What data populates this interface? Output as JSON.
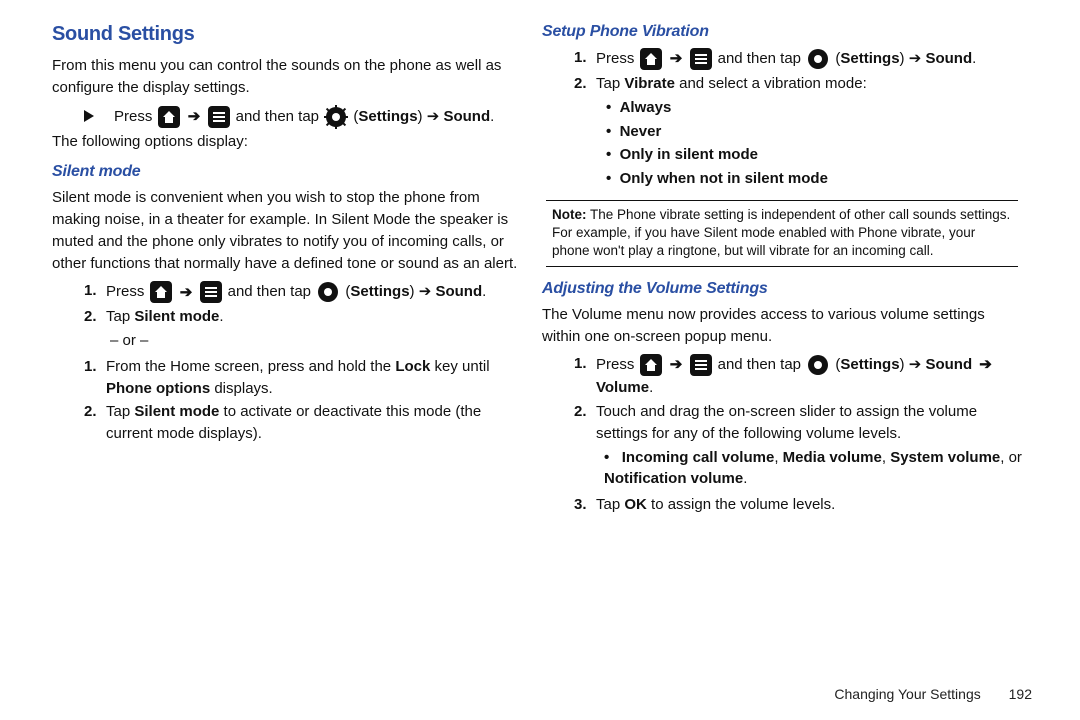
{
  "footer": {
    "section": "Changing Your Settings",
    "page": "192"
  },
  "icons": {
    "settings_label": "Settings",
    "sound_label": "Sound",
    "volume_label": "Volume"
  },
  "left": {
    "h": "Sound Settings",
    "intro": "From this menu you can control the sounds on the phone as well as configure the display settings.",
    "press": "Press ",
    "thentap": " and then tap ",
    "nav_tail1": ") ➔ ",
    "nav_tail2": ".",
    "following": "The following options display:",
    "silent_h": "Silent mode",
    "silent_p": "Silent mode is convenient when you wish to stop the phone from making noise, in a theater for example. In Silent Mode the speaker is muted and the phone only vibrates to notify you of incoming calls, or other functions that normally have a defined tone or sound as an alert.",
    "s1_2a": "Tap ",
    "s1_2b": "Silent mode",
    "s1_2c": ".",
    "or": "– or –",
    "s2_1a": "From the Home screen, press and hold the ",
    "s2_1b": "Lock",
    "s2_1c": " key until ",
    "s2_1d": "Phone options",
    "s2_1e": " displays.",
    "s2_2a": "Tap ",
    "s2_2b": "Silent mode",
    "s2_2c": " to activate or deactivate this mode (the current mode displays)."
  },
  "right": {
    "vibe_h": "Setup Phone Vibration",
    "v2a": "Tap ",
    "v2b": "Vibrate",
    "v2c": " and select a vibration mode:",
    "opts": [
      "Always",
      "Never",
      "Only in silent mode",
      "Only when not in silent mode"
    ],
    "note_label": "Note:",
    "note_body": " The Phone vibrate setting is independent of other call sounds settings. For example, if you have Silent mode enabled with Phone vibrate, your phone won't play a ringtone, but will vibrate for an incoming call.",
    "adj_h": "Adjusting the Volume Settings",
    "adj_p": "The Volume menu now provides access to various volume settings within one on-screen popup menu.",
    "a2": "Touch and drag the on-screen slider to assign the volume settings for any of the following volume levels.",
    "voltypes_a": "Incoming call volume",
    "voltypes_b": "Media volume",
    "voltypes_c": "System volume",
    "voltypes_d": "Notification volume",
    "voltypes_sep1": ", ",
    "voltypes_sep2": ", ",
    "voltypes_or": ", or ",
    "voltypes_end": ".",
    "a3a": "Tap ",
    "a3b": "OK",
    "a3c": " to assign the volume levels."
  },
  "markers": {
    "n1": "1.",
    "n2": "2.",
    "n3": "3."
  }
}
